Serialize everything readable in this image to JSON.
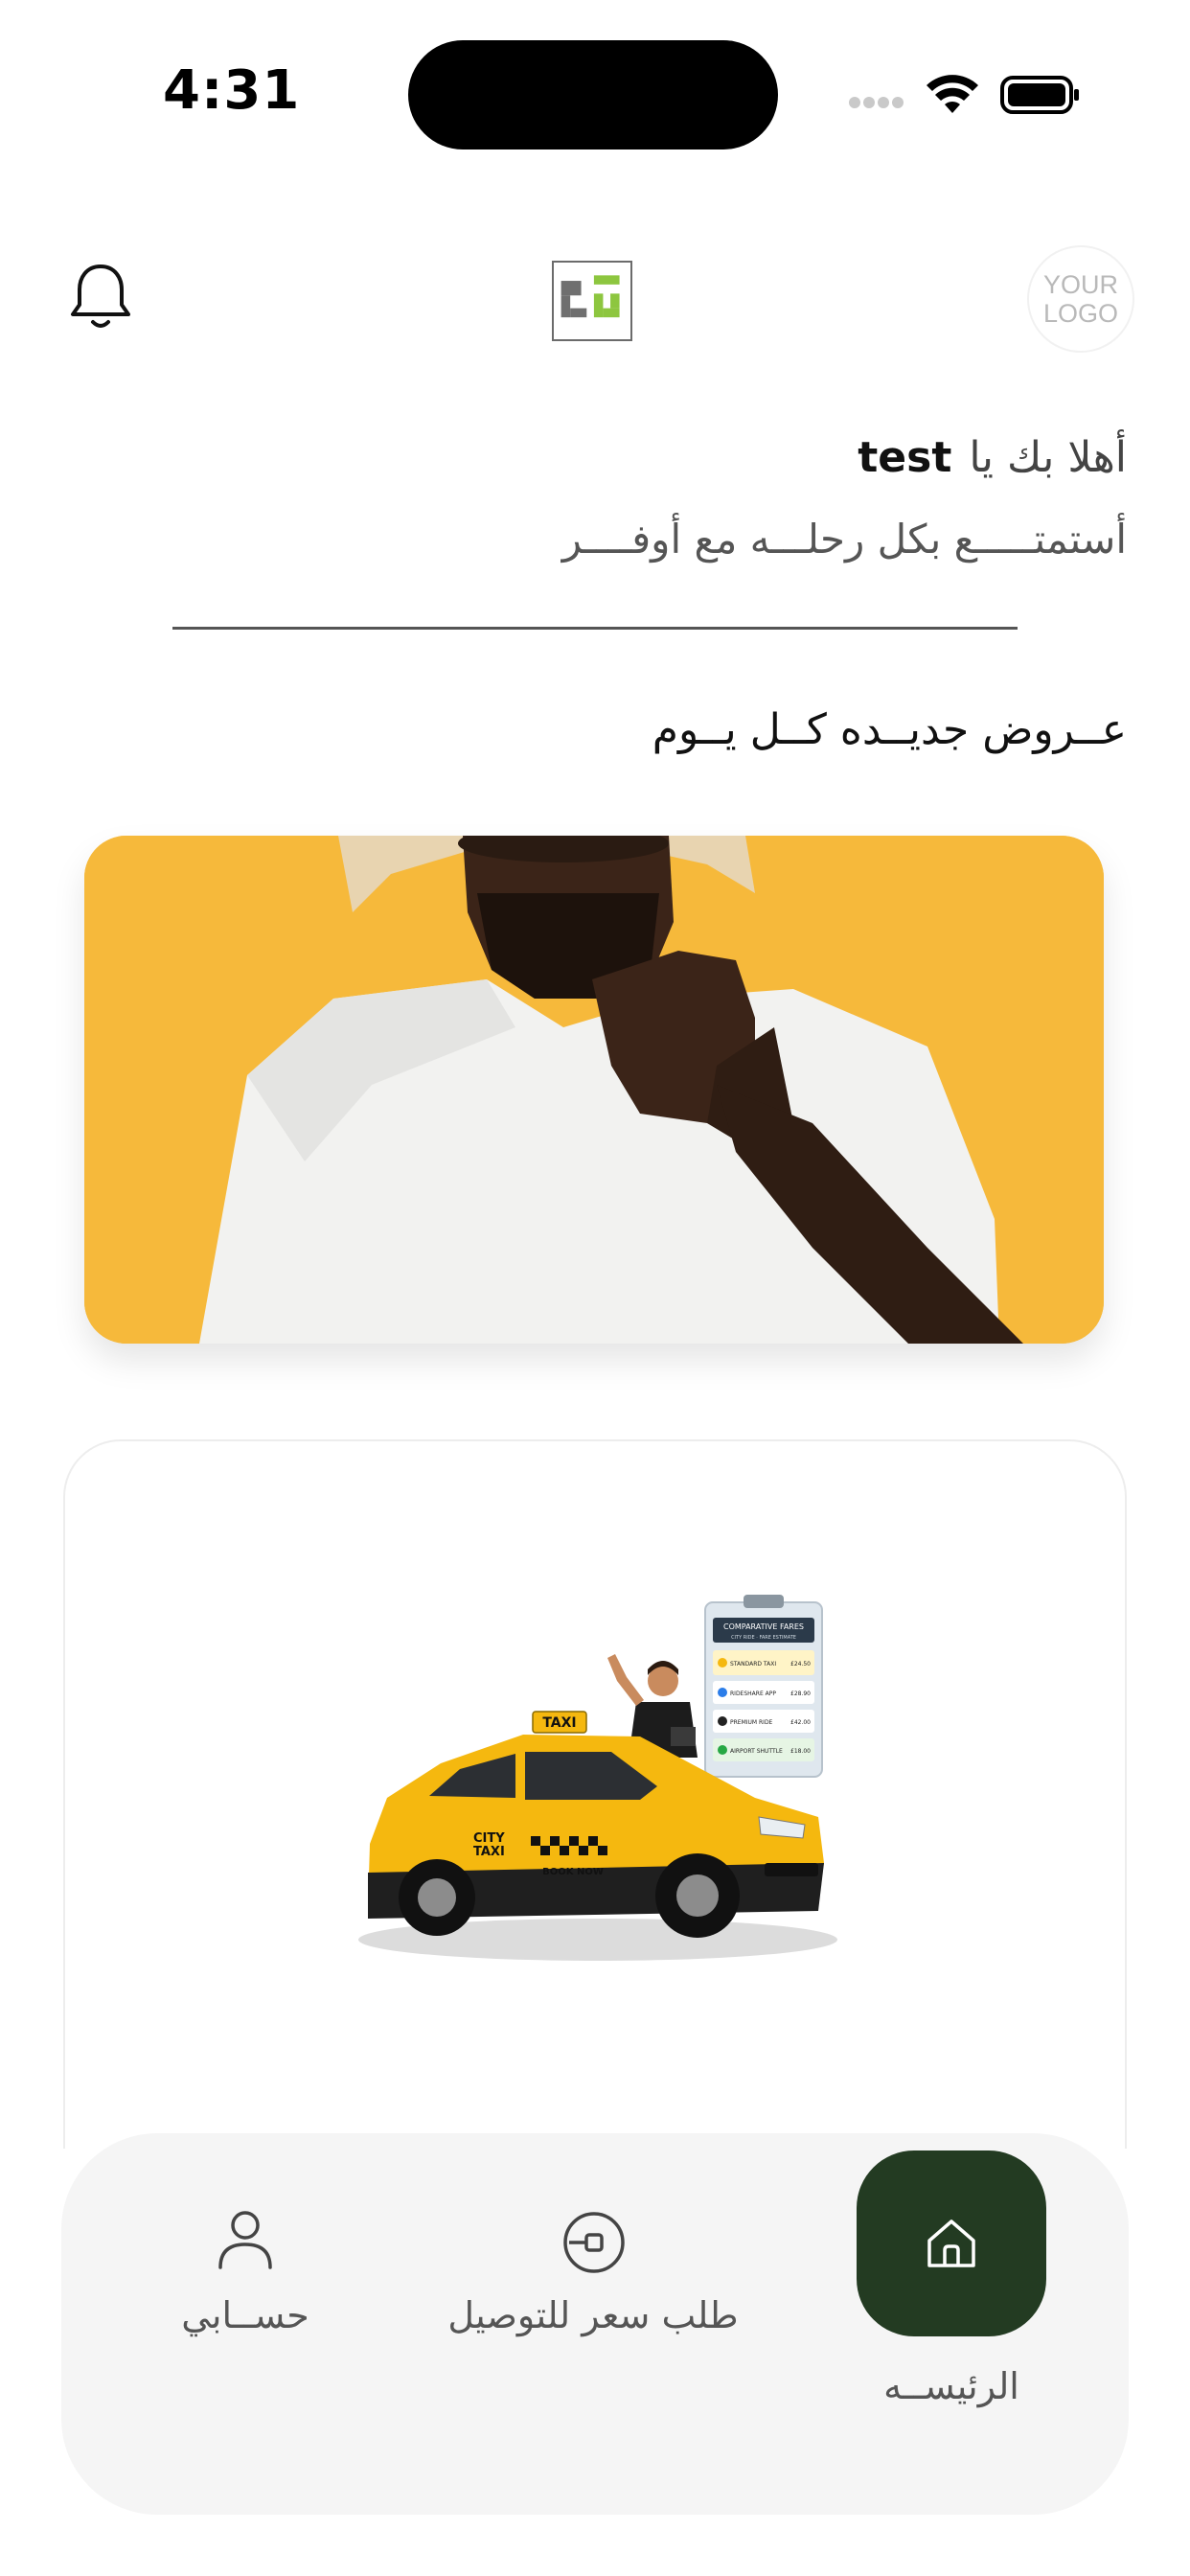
{
  "status_bar": {
    "time": "4:31"
  },
  "header": {
    "bell_icon": "bell-icon",
    "app_logo_icon": "app-logo-icon",
    "partner_logo_text_line1": "YOUR",
    "partner_logo_text_line2": "LOGO"
  },
  "greeting": {
    "prefix": "أهلا بك يا",
    "username": "test",
    "tagline": "أستمتـــــع بكل رحلـــه مع أوفــــر"
  },
  "offers": {
    "section_title": "عــروض جديــده كــل يــوم"
  },
  "taxi_card": {
    "roof_sign": "TAXI",
    "door_text_line1": "CITY",
    "door_text_line2": "TAXI",
    "door_text_line3": "BOOK NOW",
    "board_title": "COMPARATIVE FARES",
    "board_subtitle": "CITY RIDE · FARE ESTIMATE",
    "board_rows": [
      {
        "name": "STANDARD TAXI",
        "price": "£24.50"
      },
      {
        "name": "RIDESHARE APP",
        "price": "£28.90"
      },
      {
        "name": "PREMIUM RIDE",
        "price": "£42.00"
      },
      {
        "name": "AIRPORT SHUTTLE",
        "price": "£18.00"
      }
    ]
  },
  "bottom_nav": {
    "home_label": "الرئيســه",
    "request_label": "طلب سعر للتوصيل",
    "account_label": "حســابي",
    "home_icon": "home-icon",
    "request_icon": "request-price-icon",
    "account_icon": "user-icon"
  },
  "colors": {
    "nav_active": "#233b22",
    "banner_bg": "#f6b93b",
    "taxi_yellow": "#f5b80f"
  }
}
